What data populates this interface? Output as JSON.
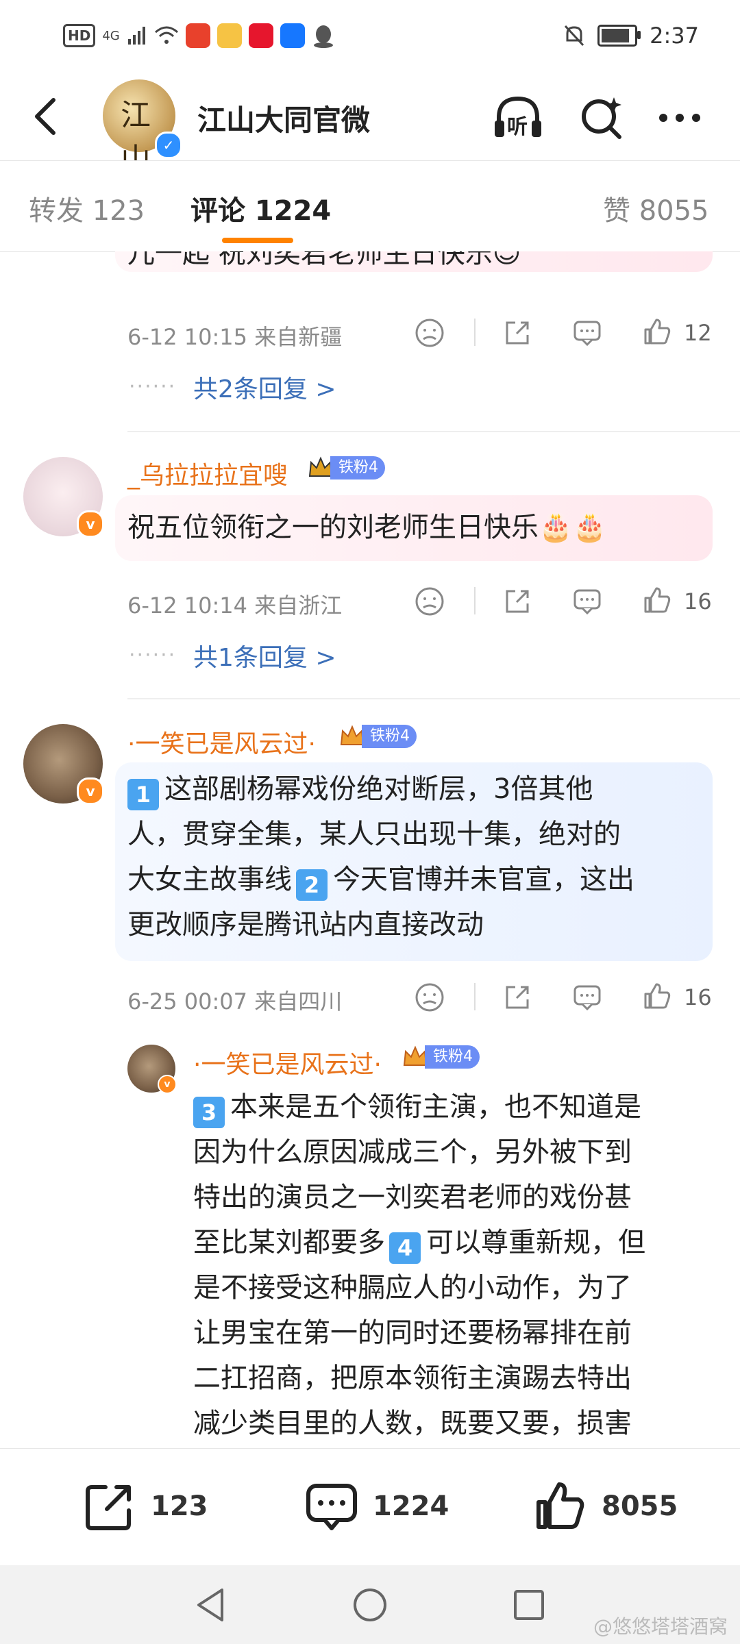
{
  "status_bar": {
    "network": "4G",
    "hd": "HD",
    "time": "2:37"
  },
  "header": {
    "title": "江山大同官微",
    "avatar_text": "江山",
    "listen_label": "听"
  },
  "tabs": [
    {
      "label": "转发 123"
    },
    {
      "label": "评论 1224"
    },
    {
      "label": "赞 8055"
    }
  ],
  "comments": [
    {
      "text_partial": "儿一起 祝刘奕君老师生日快乐",
      "time": "6-12 10:15",
      "location": "来自新疆",
      "likes": "12",
      "replies": "共2条回复 >"
    },
    {
      "username": "_乌拉拉拉宜嗖",
      "fan_badge": "铁粉4",
      "text": "祝五位领衔之一的刘老师生日快乐🎂🎂",
      "time": "6-12 10:14",
      "location": "来自浙江",
      "likes": "16",
      "replies": "共1条回复 >"
    },
    {
      "username": "·一笑已是风云过·",
      "fan_badge": "铁粉4",
      "lines": [
        "这部剧杨幂戏份绝对断层，3倍其他",
        "人，贯穿全集，某人只出现十集，绝对的",
        "大女主故事线",
        "今天官博并未官宣，这出",
        "更改顺序是腾讯站内直接改动"
      ],
      "num1": "1",
      "num2": "2",
      "time": "6-25 00:07",
      "location": "来自四川",
      "likes": "16"
    }
  ],
  "reply": {
    "username": "·一笑已是风云过·",
    "fan_badge": "铁粉4",
    "num3": "3",
    "num4": "4",
    "lines": [
      "本来是五个领衔主演，也不知道是",
      "因为什么原因减成三个，另外被下到",
      "特出的演员之一刘奕君老师的戏份甚",
      "至比某刘都要多",
      "可以尊重新规，但",
      "是不接受这种膈应人的小动作，为了",
      "让男宝在第一的同时还要杨幂排在前",
      "二扛招商，把原本领衔主演踢去特出",
      "减少类目里的人数，既要又要，损害"
    ]
  },
  "bottom_bar": {
    "repost": "123",
    "comment": "1224",
    "like": "8055"
  },
  "watermark": "@悠悠塔塔酒窝"
}
